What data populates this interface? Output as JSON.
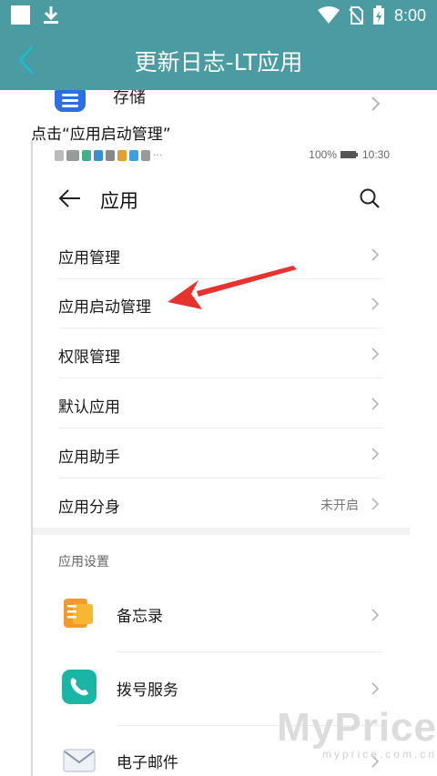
{
  "status_bar": {
    "time": "8:00"
  },
  "app_bar": {
    "title": "更新日志-LT应用"
  },
  "partial_row": {
    "label": "存储"
  },
  "caption": "点击“应用启动管理”",
  "phone": {
    "status": {
      "battery": "100%",
      "time": "10:30"
    },
    "header": {
      "title": "应用"
    },
    "menu": [
      {
        "label": "应用管理",
        "value": ""
      },
      {
        "label": "应用启动管理",
        "value": ""
      },
      {
        "label": "权限管理",
        "value": ""
      },
      {
        "label": "默认应用",
        "value": ""
      },
      {
        "label": "应用助手",
        "value": ""
      },
      {
        "label": "应用分身",
        "value": "未开启"
      }
    ],
    "section_title": "应用设置",
    "apps": [
      {
        "label": "备忘录",
        "icon": "memo-icon"
      },
      {
        "label": "拨号服务",
        "icon": "phone-icon"
      },
      {
        "label": "电子邮件",
        "icon": "email-icon"
      }
    ]
  },
  "watermark": {
    "brand": "MyPrice",
    "url": "myprice.com.cn"
  },
  "colors": {
    "primary": "#4a9ba2",
    "annotation_arrow": "#e8322e"
  }
}
